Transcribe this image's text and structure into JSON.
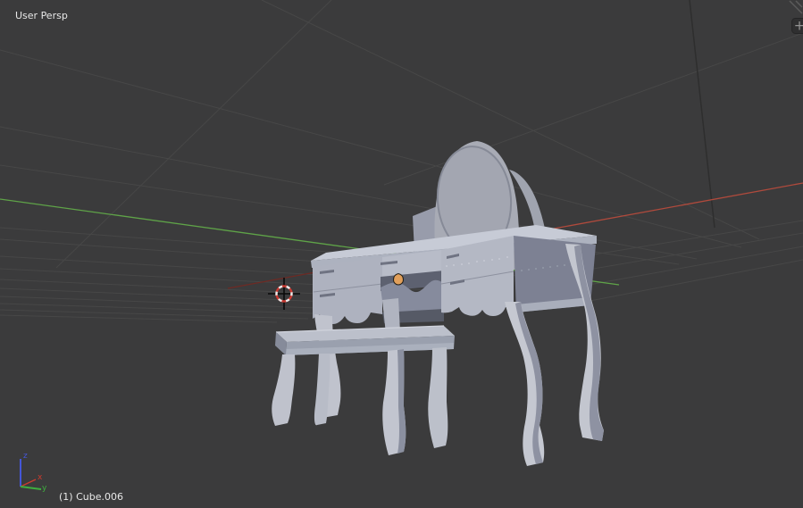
{
  "viewport": {
    "view_label": "User Persp",
    "object_info": "(1) Cube.006",
    "plus_button_glyph": "+",
    "background_color": "#3b3b3c",
    "grid_line_color": "#474747",
    "grid_dark_line_color": "#2e2e2e",
    "x_axis_bright_color": "#b04a3c",
    "x_axis_dim_color": "#6e2a24",
    "y_axis_color": "#5fa348",
    "origin_dot_color": "#e2a05b",
    "cursor": {
      "ring_red": "#cc3a32",
      "ring_white": "#ececec",
      "cross_color": "#0a0a0a"
    },
    "gizmo": {
      "x_label": "x",
      "y_label": "y",
      "z_label": "z",
      "x_color": "#cc3b2e",
      "y_color": "#3fae3f",
      "z_color": "#4456d8"
    },
    "model": {
      "name": "dressing-table-with-stool",
      "top_light": "#c7cbd6",
      "front_mid": "#b2b6c3",
      "side_dark": "#7d8193",
      "leg_light": "#c4c7d1",
      "leg_shade": "#8e92a2"
    }
  }
}
